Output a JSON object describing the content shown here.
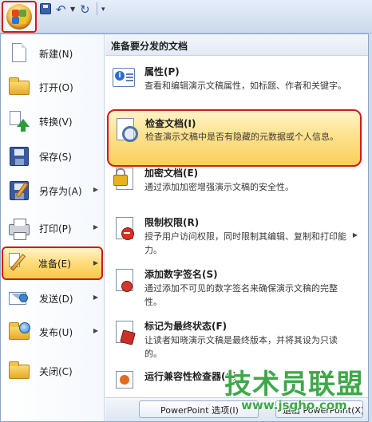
{
  "left_menu": [
    {
      "key": "new",
      "label": "新建(N)",
      "has_submenu": false
    },
    {
      "key": "open",
      "label": "打开(O)",
      "has_submenu": false
    },
    {
      "key": "convert",
      "label": "转换(V)",
      "has_submenu": false
    },
    {
      "key": "save",
      "label": "保存(S)",
      "has_submenu": false
    },
    {
      "key": "save_as",
      "label": "另存为(A)",
      "has_submenu": true
    },
    {
      "key": "print",
      "label": "打印(P)",
      "has_submenu": true
    },
    {
      "key": "prepare",
      "label": "准备(E)",
      "has_submenu": true,
      "selected": true
    },
    {
      "key": "send",
      "label": "发送(D)",
      "has_submenu": true
    },
    {
      "key": "publish",
      "label": "发布(U)",
      "has_submenu": true
    },
    {
      "key": "close",
      "label": "关闭(C)",
      "has_submenu": false
    }
  ],
  "right_pane": {
    "header": "准备要分发的文档",
    "items": [
      {
        "key": "properties",
        "title": "属性(P)",
        "desc": "查看和编辑演示文稿属性，如标题、作者和关键字。"
      },
      {
        "key": "inspect",
        "title": "检查文档(I)",
        "desc": "检查演示文稿中是否有隐藏的元数据或个人信息。",
        "highlighted": true
      },
      {
        "key": "encrypt",
        "title": "加密文档(E)",
        "desc": "通过添加加密增强演示文稿的安全性。"
      },
      {
        "key": "restrict",
        "title": "限制权限(R)",
        "desc": "授予用户访问权限，同时限制其编辑、复制和打印能力。",
        "has_submenu": true
      },
      {
        "key": "signature",
        "title": "添加数字签名(S)",
        "desc": "通过添加不可见的数字签名来确保演示文稿的完整性。"
      },
      {
        "key": "final",
        "title": "标记为最终状态(F)",
        "desc": "让读者知晓演示文稿是最终版本，并将其设为只读的。"
      },
      {
        "key": "compat",
        "title": "运行兼容性检查器(C)",
        "desc": ""
      }
    ]
  },
  "bottom": {
    "options_label": "PowerPoint 选项(I)",
    "exit_label": "退出 PowerPoint(X)"
  },
  "watermark": {
    "text": "技术员联盟",
    "url": "www.jsgho.com"
  },
  "colors": {
    "highlight_border": "#d11a1a",
    "highlight_fill": "#fedc7b",
    "watermark": "#3fa84a"
  }
}
